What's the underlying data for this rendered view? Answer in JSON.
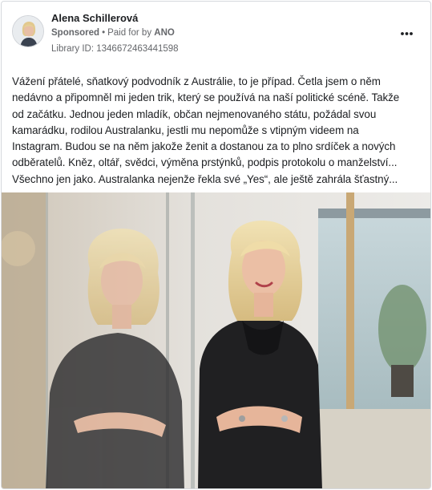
{
  "post": {
    "author": "Alena Schillerová",
    "sponsored_label": "Sponsored",
    "separator": "•",
    "paid_for_label": "Paid for by",
    "payer": "ANO",
    "library_id": "Library ID: 1346672463441598",
    "text_lines": [
      "Vážení přátelé, sňatkový podvodník z Austrálie, to je případ. Četla jsem o něm",
      "nedávno a připomněl mi jeden trik, který se používá na naší politické scéně. Takže",
      "od začátku. Jednou jeden mladík, občan nejmenovaného státu, požádal svou",
      "kamarádku, rodilou Australanku, jestli mu nepomůže s vtipným videem na",
      "Instagram. Budou se na něm jakože ženit a dostanou za to plno srdíček a nových",
      "odběratelů. Kněz, oltář, svědci, výměna prstýnků, podpis protokolu o manželství...",
      "Všechno jen jako. Australanka nejenže řekla své „Yes“, ale ještě zahrála šťastný..."
    ]
  },
  "icons": {
    "more_options": "more-horizontal-icon",
    "avatar": "profile-photo"
  },
  "colors": {
    "text_primary": "#1c1e21",
    "text_secondary": "#65676b",
    "border": "#d6d9dd"
  }
}
